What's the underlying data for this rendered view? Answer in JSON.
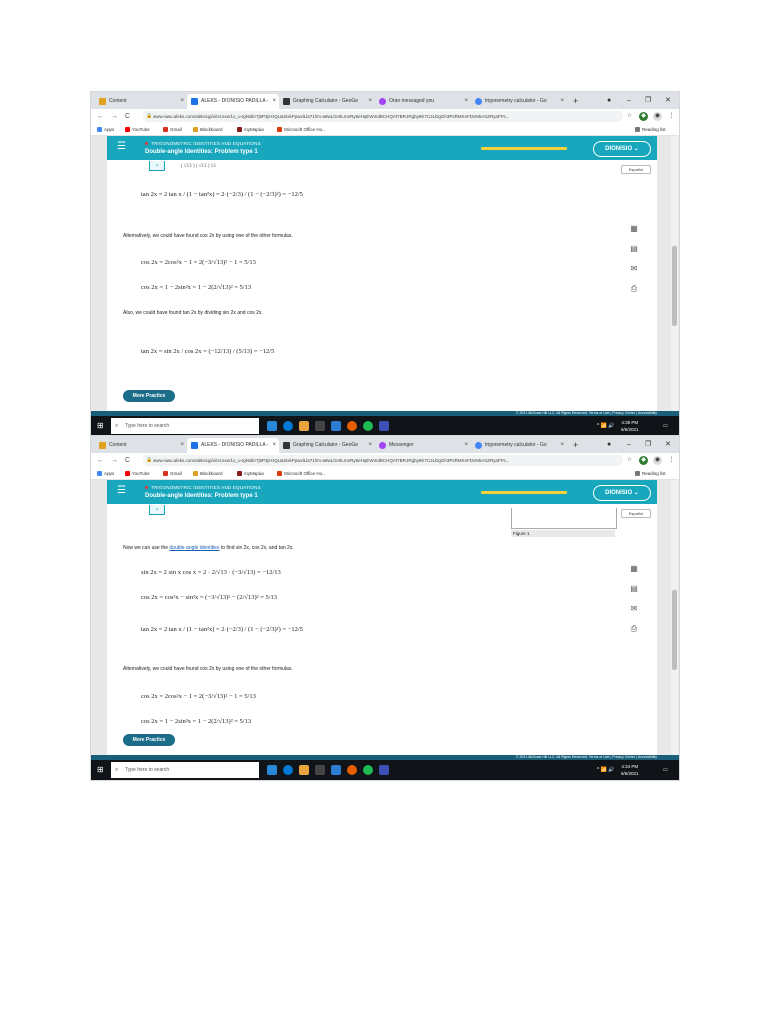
{
  "browser": {
    "tabs": [
      {
        "label": "Content",
        "icon_color": "#e0a020"
      },
      {
        "label": "ALEKS - DIONISIO PADILLA -",
        "icon_color": "#1a73e8"
      },
      {
        "label": "Graphing Calculator - GeoGe",
        "icon_color": "#333333"
      },
      {
        "label": "Oran messaged you",
        "icon_color": "#a142f4"
      },
      {
        "label": "trigonometry calculator - Go",
        "icon_color": "#4285f4"
      }
    ],
    "tabs2": [
      {
        "label": "Content",
        "icon_color": "#e0a020"
      },
      {
        "label": "ALEKS - DIONISIO PADILLA -",
        "icon_color": "#1a73e8"
      },
      {
        "label": "Graphing Calculator - GeoGe",
        "icon_color": "#333333"
      },
      {
        "label": "Messenger",
        "icon_color": "#a142f4"
      },
      {
        "label": "trigonometry calculator - Go",
        "icon_color": "#4285f4"
      }
    ],
    "tab_close": "×",
    "new_tab": "+",
    "window_controls": {
      "minimize": "–",
      "restore": "❐",
      "close": "✕"
    },
    "url": "www-awu.aleks.com/alekscgi/x/Isl.exe/1o_u-IgNslkr7j8P3jH-lQUa2IxkPpwxlLla71lrm-a8wL0A9LmnRy5eHqEWmdBCHQATrBR1Rgby9K7C2LDgGh3PsRMXnFDvN5ASZRyaFFs...",
    "nav": {
      "back": "←",
      "forward": "→",
      "reload": "C"
    },
    "bookmarks": [
      {
        "label": "Apps",
        "color": "#4285f4"
      },
      {
        "label": "YouTube",
        "color": "#ff0000"
      },
      {
        "label": "Gmail",
        "color": "#d93025"
      },
      {
        "label": "Blackboard",
        "color": "#333333"
      },
      {
        "label": "myMapúa",
        "color": "#8a1c1c"
      },
      {
        "label": "Microsoft Office Ho...",
        "color": "#d83b01"
      }
    ],
    "reading_list": "Reading list"
  },
  "aleks": {
    "topic": "TRIGONOMETRIC IDENTITIES AND EQUATIONS",
    "title": "Double-angle Identities: Problem type 1",
    "user": "DIONISIO ⌄",
    "espanol": "Español",
    "more_practice": "More Practice",
    "footer": "© 2021 McGraw Hill LLC. All Rights Reserved.   Terms of Use  |  Privacy Center  |  Accessibility",
    "figure_label": "Figure 1",
    "menu_icon": "☰",
    "chevron": "⌄"
  },
  "shot1": {
    "tan_line": "tan 2x = 2 tan x / (1 − tan²x) = 2·(−2/3) / (1 − (−2/3)²) = −12/5",
    "alt_text": "Alternatively, we could have found cos 2x by using one of the other formulas.",
    "cos_alt1": "cos 2x = 2cos²x − 1 = 2(−3/√13)² − 1 = 5/13",
    "cos_alt2": "cos 2x = 1 − 2sin²x = 1 − 2(2/√13)² = 5/13",
    "also_text": "Also, we could have found tan 2x by dividing sin 2x and cos 2x.",
    "tan_div": "tan 2x = sin 2x / cos 2x = (−12/13) / (5/13) = −12/5",
    "top_cut": "(  √13  )     (  √13  )      13"
  },
  "shot2": {
    "intro_before": "Now we can use the ",
    "intro_link": "double-angle identities",
    "intro_after": " to find sin 2x, cos 2x, and tan 2x.",
    "sin_line": "sin 2x = 2 sin x cos x = 2 · 2/√13 · (−3/√13) = −12/13",
    "cos_line": "cos 2x = cos²x − sin²x = (−3/√13)² − (2/√13)² = 5/13",
    "tan_line": "tan 2x = 2 tan x / (1 − tan²x) = 2·(−2/3) / (1 − (−2/3)²) = −12/5",
    "alt_text": "Alternatively, we could have found cos 2x by using one of the other formulas.",
    "cos_alt1": "cos 2x = 2cos²x − 1 = 2(−3/√13)² − 1 = 5/13",
    "cos_alt2": "cos 2x = 1 − 2sin²x = 1 − 2(2/√13)² = 5/13"
  },
  "taskbar": {
    "search_placeholder": "Type here to search",
    "tray": "^ 📶 🔊",
    "time1": "4:35 PM",
    "date1": "6/6/2021",
    "time2": "4:34 PM",
    "date2": "6/6/2021",
    "icons": [
      "#2b88d8",
      "#0078d4",
      "#e8a33c",
      "#444444",
      "#2d7dd2",
      "#e65c00",
      "#1db954",
      "#3f51b5"
    ]
  }
}
